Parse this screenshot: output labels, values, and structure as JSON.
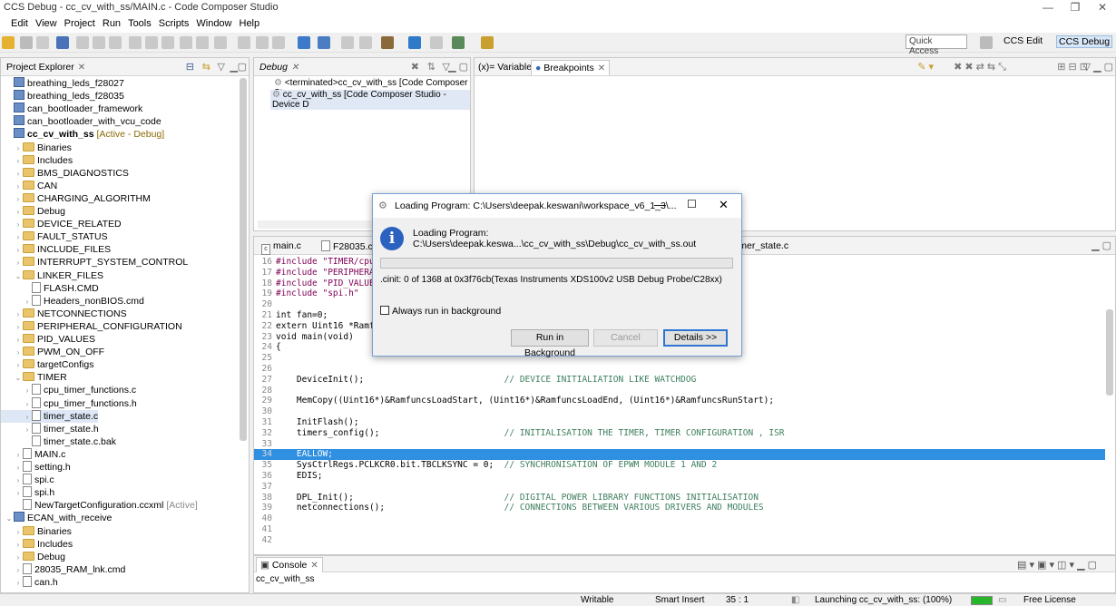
{
  "window": {
    "title": "CCS Debug - cc_cv_with_ss/MAIN.c - Code Composer Studio",
    "min": "—",
    "max": "❐",
    "close": "✕"
  },
  "menu": [
    "Edit",
    "View",
    "Project",
    "Run",
    "Tools",
    "Scripts",
    "Window",
    "Help"
  ],
  "toolbar": {
    "quick_access": "Quick Access",
    "persp1": "CCS Edit",
    "persp2": "CCS Debug"
  },
  "project_explorer": {
    "title": "Project Explorer",
    "items": [
      {
        "label": "breathing_leds_f28027",
        "depth": 0,
        "kind": "proj",
        "arrow": ""
      },
      {
        "label": "breathing_leds_f28035",
        "depth": 0,
        "kind": "proj",
        "arrow": ""
      },
      {
        "label": "can_bootloader_framework",
        "depth": 0,
        "kind": "proj",
        "arrow": ""
      },
      {
        "label": "can_bootloader_with_vcu_code",
        "depth": 0,
        "kind": "proj",
        "arrow": ""
      },
      {
        "label": "cc_cv_with_ss",
        "depth": 0,
        "kind": "proj",
        "arrow": "",
        "tag": "[Active - Debug]",
        "bold": true
      },
      {
        "label": "Binaries",
        "depth": 1,
        "kind": "fold",
        "arrow": "›"
      },
      {
        "label": "Includes",
        "depth": 1,
        "kind": "fold",
        "arrow": "›"
      },
      {
        "label": "BMS_DIAGNOSTICS",
        "depth": 1,
        "kind": "fold",
        "arrow": "›"
      },
      {
        "label": "CAN",
        "depth": 1,
        "kind": "fold",
        "arrow": "›"
      },
      {
        "label": "CHARGING_ALGORITHM",
        "depth": 1,
        "kind": "fold",
        "arrow": "›"
      },
      {
        "label": "Debug",
        "depth": 1,
        "kind": "fold",
        "arrow": "›"
      },
      {
        "label": "DEVICE_RELATED",
        "depth": 1,
        "kind": "fold",
        "arrow": "›"
      },
      {
        "label": "FAULT_STATUS",
        "depth": 1,
        "kind": "fold",
        "arrow": "›"
      },
      {
        "label": "INCLUDE_FILES",
        "depth": 1,
        "kind": "fold",
        "arrow": "›"
      },
      {
        "label": "INTERRUPT_SYSTEM_CONTROL",
        "depth": 1,
        "kind": "fold",
        "arrow": "›"
      },
      {
        "label": "LINKER_FILES",
        "depth": 1,
        "kind": "fold",
        "arrow": "⌄"
      },
      {
        "label": "FLASH.CMD",
        "depth": 2,
        "kind": "file",
        "arrow": ""
      },
      {
        "label": "Headers_nonBIOS.cmd",
        "depth": 2,
        "kind": "file",
        "arrow": "›"
      },
      {
        "label": "NETCONNECTIONS",
        "depth": 1,
        "kind": "fold",
        "arrow": "›"
      },
      {
        "label": "PERIPHERAL_CONFIGURATION",
        "depth": 1,
        "kind": "fold",
        "arrow": "›"
      },
      {
        "label": "PID_VALUES",
        "depth": 1,
        "kind": "fold",
        "arrow": "›"
      },
      {
        "label": "PWM_ON_OFF",
        "depth": 1,
        "kind": "fold",
        "arrow": "›"
      },
      {
        "label": "targetConfigs",
        "depth": 1,
        "kind": "fold",
        "arrow": "›"
      },
      {
        "label": "TIMER",
        "depth": 1,
        "kind": "fold",
        "arrow": "⌄"
      },
      {
        "label": "cpu_timer_functions.c",
        "depth": 2,
        "kind": "file",
        "arrow": "›"
      },
      {
        "label": "cpu_timer_functions.h",
        "depth": 2,
        "kind": "file",
        "arrow": "›"
      },
      {
        "label": "timer_state.c",
        "depth": 2,
        "kind": "file",
        "arrow": "›",
        "selected": true
      },
      {
        "label": "timer_state.h",
        "depth": 2,
        "kind": "file",
        "arrow": "›"
      },
      {
        "label": "timer_state.c.bak",
        "depth": 2,
        "kind": "file",
        "arrow": ""
      },
      {
        "label": "MAIN.c",
        "depth": 1,
        "kind": "file",
        "arrow": "›"
      },
      {
        "label": "setting.h",
        "depth": 1,
        "kind": "file",
        "arrow": "›"
      },
      {
        "label": "spi.c",
        "depth": 1,
        "kind": "file",
        "arrow": "›"
      },
      {
        "label": "spi.h",
        "depth": 1,
        "kind": "file",
        "arrow": "›"
      },
      {
        "label": "NewTargetConfiguration.ccxml",
        "depth": 1,
        "kind": "file",
        "arrow": "",
        "tag": "[Active]",
        "gray": true
      },
      {
        "label": "ECAN_with_receive",
        "depth": 0,
        "kind": "proj",
        "arrow": "⌄"
      },
      {
        "label": "Binaries",
        "depth": 1,
        "kind": "fold",
        "arrow": "›"
      },
      {
        "label": "Includes",
        "depth": 1,
        "kind": "fold",
        "arrow": "›"
      },
      {
        "label": "Debug",
        "depth": 1,
        "kind": "fold",
        "arrow": "›"
      },
      {
        "label": "28035_RAM_lnk.cmd",
        "depth": 1,
        "kind": "file",
        "arrow": "›"
      },
      {
        "label": "can.h",
        "depth": 1,
        "kind": "file",
        "arrow": "›"
      }
    ]
  },
  "debug_view": {
    "title": "Debug",
    "items": [
      "<terminated>cc_cv_with_ss [Code Composer Stu",
      "cc_cv_with_ss [Code Composer Studio - Device D"
    ]
  },
  "variables": {
    "tab1": "Variables",
    "tab2": "Breakpoints"
  },
  "editor": {
    "tabs": [
      "main.c",
      "F28035.cm",
      "timer_state.c"
    ],
    "lines": [
      {
        "n": "16",
        "code": "#include \"TIMER/cpu_",
        "kw": true
      },
      {
        "n": "17",
        "code": "#include \"PERIPHERA",
        "kw": true
      },
      {
        "n": "18",
        "code": "#include \"PID_VALUES",
        "kw": true
      },
      {
        "n": "19",
        "code": "#include \"spi.h\"",
        "kw": true
      },
      {
        "n": "20",
        "code": ""
      },
      {
        "n": "21",
        "code": "int fan=0;"
      },
      {
        "n": "22",
        "code": "extern Uint16 *Ramfu"
      },
      {
        "n": "23",
        "code": "void main(void)"
      },
      {
        "n": "24",
        "code": "{"
      },
      {
        "n": "25",
        "code": ""
      },
      {
        "n": "26",
        "code": ""
      },
      {
        "n": "27",
        "code": "    DeviceInit();                           ",
        "comment": "// DEVICE INITIALIATION LIKE WATCHDOG"
      },
      {
        "n": "28",
        "code": ""
      },
      {
        "n": "29",
        "code": "    MemCopy((Uint16*)&RamfuncsLoadStart, (Uint16*)&RamfuncsLoadEnd, (Uint16*)&RamfuncsRunStart);"
      },
      {
        "n": "30",
        "code": ""
      },
      {
        "n": "31",
        "code": "    InitFlash();"
      },
      {
        "n": "32",
        "code": "    timers_config();                        ",
        "comment": "// INITIALISATION THE TIMER, TIMER CONFIGURATION , ISR"
      },
      {
        "n": "33",
        "code": ""
      },
      {
        "n": "34",
        "code": "    EALLOW;",
        "hl": true
      },
      {
        "n": "35",
        "code": "    SysCtrlRegs.PCLKCR0.bit.TBCLKSYNC = 0;  ",
        "comment": "// SYNCHRONISATION OF EPWM MODULE 1 AND 2"
      },
      {
        "n": "36",
        "code": "    EDIS;"
      },
      {
        "n": "37",
        "code": ""
      },
      {
        "n": "38",
        "code": "    DPL_Init();                             ",
        "comment": "// DIGITAL POWER LIBRARY FUNCTIONS INITIALISATION"
      },
      {
        "n": "39",
        "code": "    netconnections();                       ",
        "comment": "// CONNECTIONS BETWEEN VARIOUS DRIVERS AND MODULES"
      },
      {
        "n": "40",
        "code": ""
      },
      {
        "n": "41",
        "code": ""
      },
      {
        "n": "42",
        "code": ""
      }
    ]
  },
  "console": {
    "title": "Console",
    "content": "cc_cv_with_ss"
  },
  "status": {
    "writable": "Writable",
    "insert": "Smart Insert",
    "pos": "35 : 1",
    "launch": "Launching cc_cv_with_ss: (100%)",
    "license": "Free License"
  },
  "dialog": {
    "title": "Loading Program: C:\\Users\\deepak.keswani\\workspace_v6_1_3\\...",
    "message": "Loading Program: C:\\Users\\deepak.keswa...\\cc_cv_with_ss\\Debug\\cc_cv_with_ss.out",
    "detail": ".cinit: 0 of 1368 at 0x3f76cb(Texas Instruments XDS100v2 USB Debug Probe/C28xx)",
    "checkbox": "Always run in background",
    "btn_background": "Run in Background",
    "btn_cancel": "Cancel",
    "btn_details": "Details >>"
  }
}
